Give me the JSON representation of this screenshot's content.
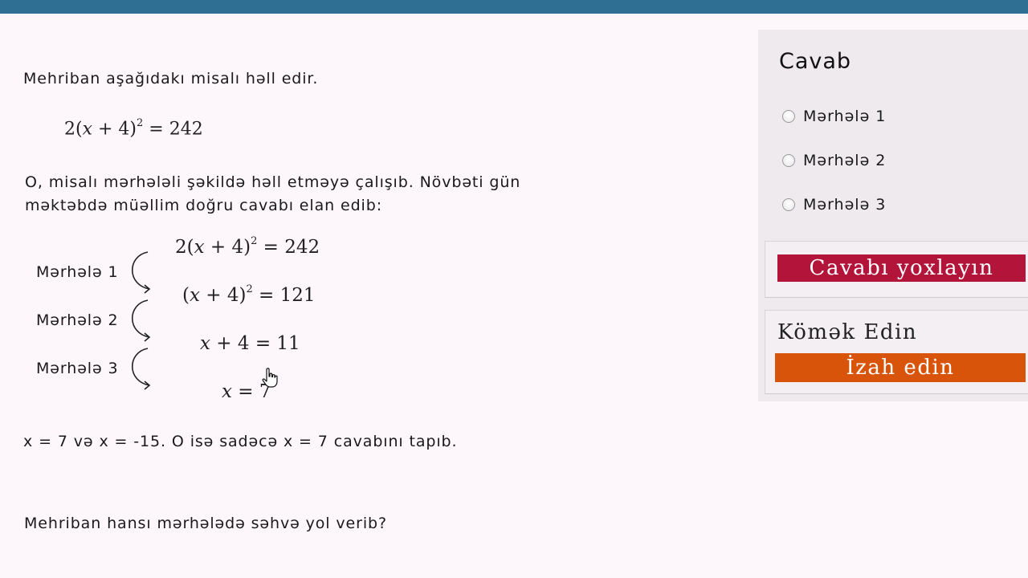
{
  "question": {
    "intro": "Mehriban aşağıdakı misalı həll edir.",
    "equation": {
      "coef": "2(",
      "var": "x",
      "rest": " + 4)",
      "exp": "2",
      "rhs": " = 242"
    },
    "desc_line1": "O, misalı mərhələli şəkildə həll etməyə çalışıb. Növbəti gün",
    "desc_line2": "məktəbdə müəllim doğru cavabı elan edib:",
    "steps": [
      {
        "label": "Mərhələ 1"
      },
      {
        "label": "Mərhələ 2"
      },
      {
        "label": "Mərhələ 3"
      }
    ],
    "chain": [
      {
        "pre": "2(",
        "var": "x",
        "mid": " + 4)",
        "exp": "2",
        "rhs": " = 242"
      },
      {
        "pre": "(",
        "var": "x",
        "mid": " + 4)",
        "exp": "2",
        "rhs": " = 121"
      },
      {
        "pre": "",
        "var": "x",
        "mid": " + 4 = 11",
        "exp": "",
        "rhs": ""
      },
      {
        "pre": "",
        "var": "x",
        "mid": " = 7",
        "exp": "",
        "rhs": ""
      }
    ],
    "answer_note": "x = 7 və x = -15. O isə sadəcə x = 7 cavabını tapıb.",
    "prompt": "Mehriban hansı mərhələdə səhvə yol verib?"
  },
  "panel": {
    "title": "Cavab",
    "options": [
      "Mərhələ 1",
      "Mərhələ 2",
      "Mərhələ 3"
    ],
    "check_label": "Cavabı yoxlayın",
    "help_title": "Kömək Edin",
    "explain_label": "İzah edin"
  },
  "colors": {
    "top_bar": "#2e6f93",
    "check_button": "#b3143a",
    "explain_button": "#d9540b",
    "background": "#fdf6fb"
  }
}
